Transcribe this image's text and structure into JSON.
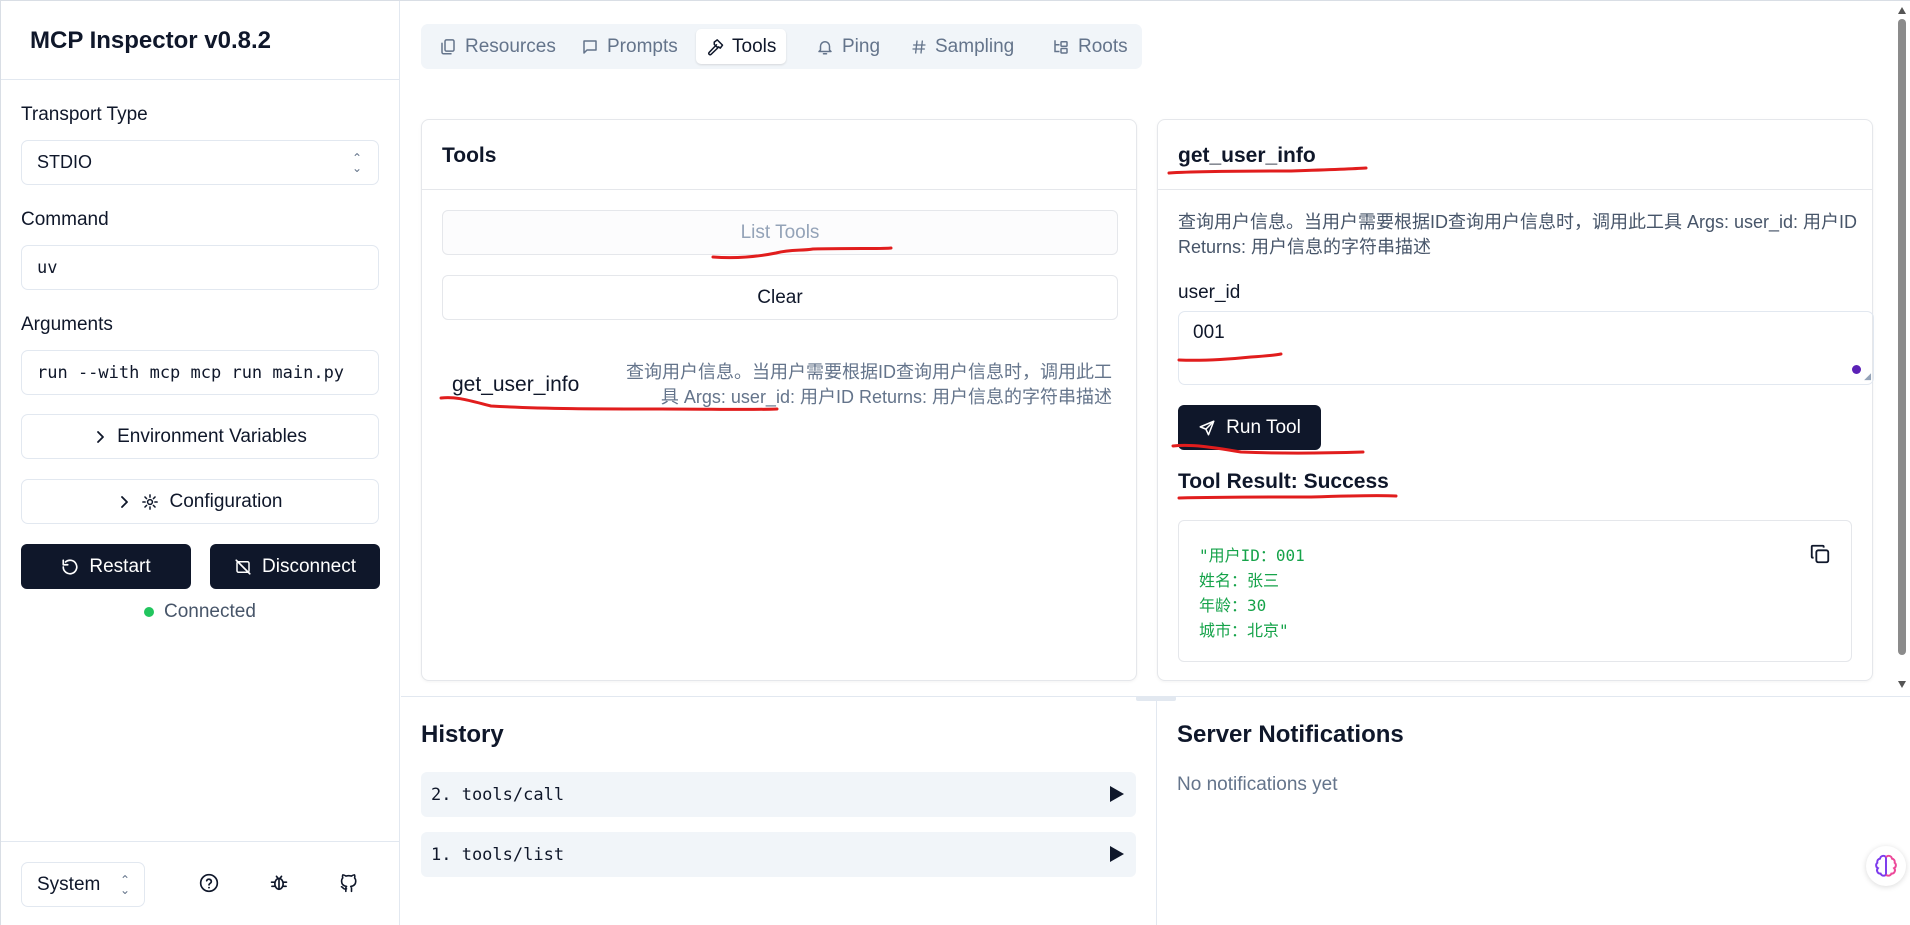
{
  "app": {
    "title": "MCP Inspector v0.8.2"
  },
  "sidebar": {
    "transport_label": "Transport Type",
    "transport_value": "STDIO",
    "command_label": "Command",
    "command_value": "uv",
    "arguments_label": "Arguments",
    "arguments_value": "run --with mcp mcp run main.py",
    "env_button": "Environment Variables",
    "config_button": "Configuration",
    "restart_button": "Restart",
    "disconnect_button": "Disconnect",
    "status_text": "Connected",
    "theme_value": "System"
  },
  "tabs": [
    {
      "label": "Resources",
      "icon": "files-icon"
    },
    {
      "label": "Prompts",
      "icon": "message-icon"
    },
    {
      "label": "Tools",
      "icon": "hammer-icon",
      "active": true
    },
    {
      "label": "Ping",
      "icon": "bell-icon"
    },
    {
      "label": "Sampling",
      "icon": "hash-icon"
    },
    {
      "label": "Roots",
      "icon": "folder-tree-icon"
    }
  ],
  "tools_panel": {
    "title": "Tools",
    "list_button": "List Tools",
    "clear_button": "Clear",
    "items": [
      {
        "name": "get_user_info",
        "description": "查询用户信息。当用户需要根据ID查询用户信息时，调用此工具 Args: user_id: 用户ID Returns: 用户信息的字符串描述"
      }
    ]
  },
  "tool_detail": {
    "title": "get_user_info",
    "description": "查询用户信息。当用户需要根据ID查询用户信息时，调用此工具 Args: user_id: 用户ID Returns: 用户信息的字符串描述",
    "param_label": "user_id",
    "param_value": "001",
    "run_button": "Run Tool",
    "result_title": "Tool Result: Success",
    "result_text": "\"用户ID：001\n姓名：张三\n年龄：30\n城市：北京\""
  },
  "history": {
    "title": "History",
    "items": [
      "2. tools/call",
      "1. tools/list"
    ]
  },
  "notifications": {
    "title": "Server Notifications",
    "empty_text": "No notifications yet"
  },
  "colors": {
    "primary": "#0f172a",
    "success": "#22c55e",
    "result_text": "#16a34a",
    "annotation": "#e11d1d"
  }
}
